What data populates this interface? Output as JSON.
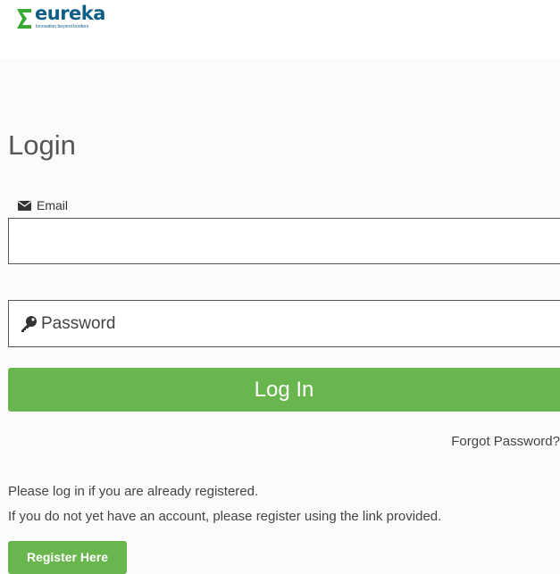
{
  "header": {
    "logo": {
      "word": "eureka",
      "tagline": "Innovation beyond borders",
      "sigma_color": "#3aaa35",
      "text_color": "#0f5e86"
    }
  },
  "login": {
    "title": "Login",
    "email": {
      "label": "Email",
      "icon": "envelope-icon",
      "value": ""
    },
    "password": {
      "placeholder": "Password",
      "icon": "key-icon",
      "value": ""
    },
    "submit_label": "Log In",
    "forgot_label": "Forgot Password?"
  },
  "info": {
    "line1": "Please log in if you are already registered.",
    "line2": "If you do not yet have an account, please register using the link provided."
  },
  "register": {
    "label": "Register Here"
  },
  "colors": {
    "accent_green": "#6ab64e",
    "page_background": "#fbfbfb",
    "border": "#555555"
  }
}
